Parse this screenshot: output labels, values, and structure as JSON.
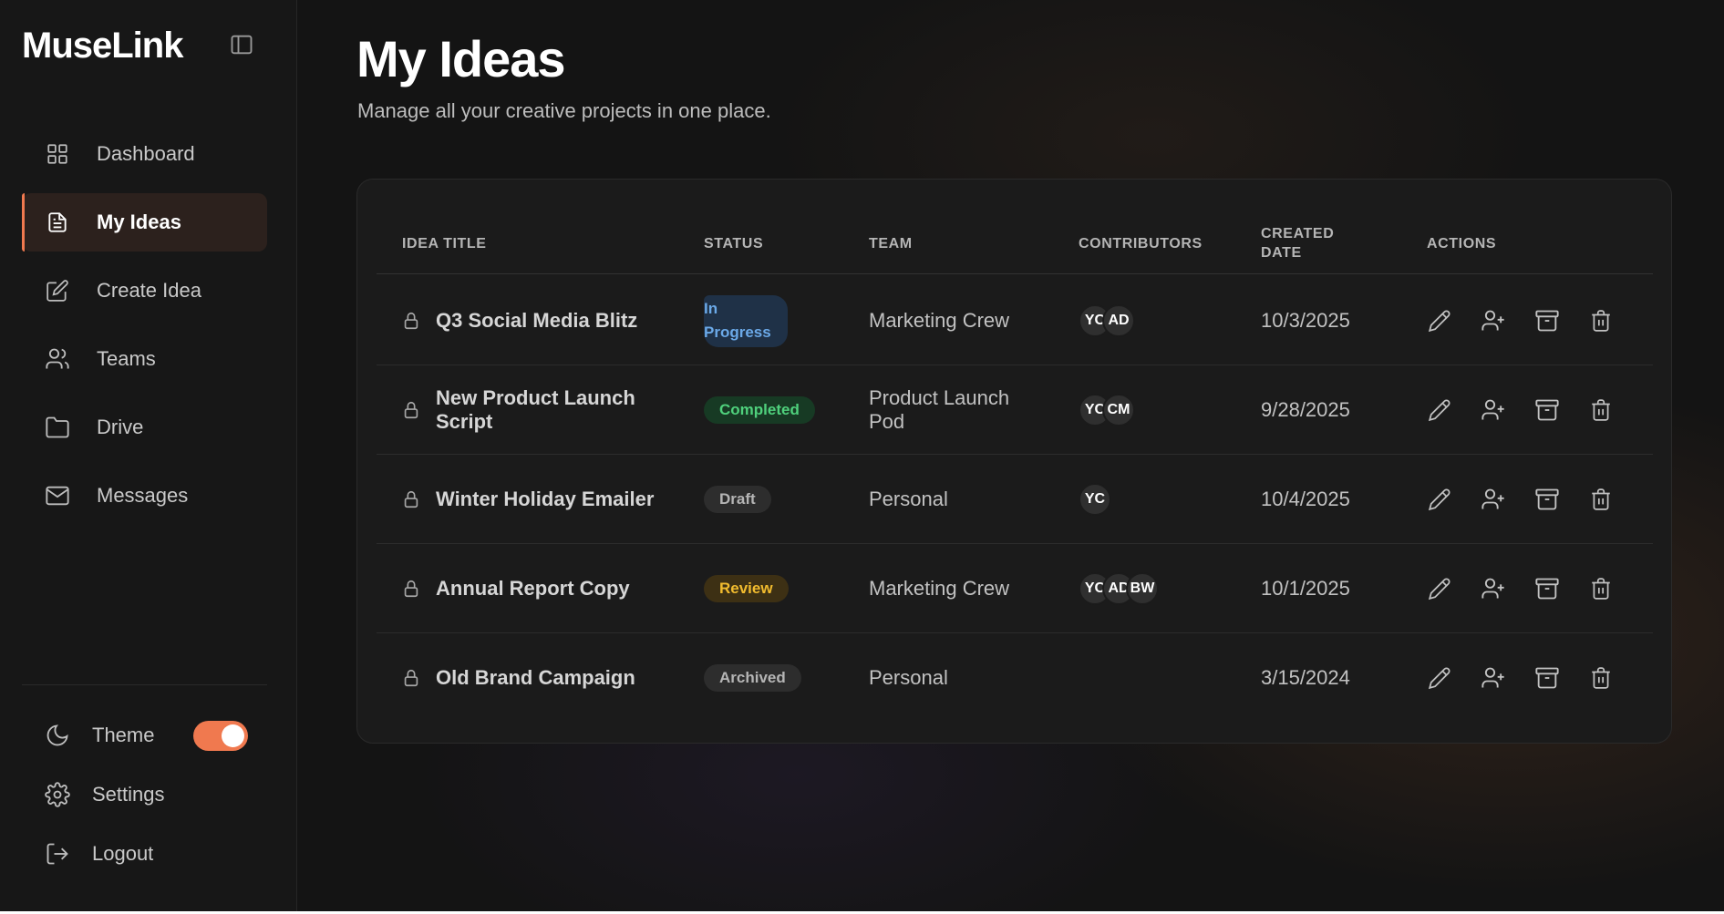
{
  "sidebar": {
    "brand": "MuseLink",
    "items": [
      {
        "label": "Dashboard",
        "icon": "grid-icon"
      },
      {
        "label": "My Ideas",
        "icon": "document-icon",
        "active": true
      },
      {
        "label": "Create Idea",
        "icon": "pencil-square-icon"
      },
      {
        "label": "Teams",
        "icon": "users-icon"
      },
      {
        "label": "Drive",
        "icon": "folder-icon"
      },
      {
        "label": "Messages",
        "icon": "mail-icon"
      }
    ],
    "theme_label": "Theme",
    "theme_on": true,
    "settings_label": "Settings",
    "logout_label": "Logout"
  },
  "header": {
    "title": "My Ideas",
    "subtitle": "Manage all your creative projects in one place."
  },
  "table": {
    "columns": {
      "title": "Idea Title",
      "status": "Status",
      "team": "Team",
      "contributors": "Contributors",
      "created": "Created Date",
      "actions": "Actions"
    },
    "rows": [
      {
        "title": "Q3 Social Media Blitz",
        "status": "In Progress",
        "status_kind": "progress",
        "team": "Marketing Crew",
        "contributors": [
          "YC",
          "AD"
        ],
        "date": "10/3/2025"
      },
      {
        "title": "New Product Launch Script",
        "status": "Completed",
        "status_kind": "completed",
        "team": "Product Launch Pod",
        "contributors": [
          "YC",
          "CM"
        ],
        "date": "9/28/2025"
      },
      {
        "title": "Winter Holiday Emailer",
        "status": "Draft",
        "status_kind": "draft",
        "team": "Personal",
        "contributors": [
          "YC"
        ],
        "date": "10/4/2025"
      },
      {
        "title": "Annual Report Copy",
        "status": "Review",
        "status_kind": "review",
        "team": "Marketing Crew",
        "contributors": [
          "YC",
          "AD",
          "BW"
        ],
        "date": "10/1/2025"
      },
      {
        "title": "Old Brand Campaign",
        "status": "Archived",
        "status_kind": "archived",
        "team": "Personal",
        "contributors": [],
        "date": "3/15/2024"
      }
    ]
  },
  "colors": {
    "accent": "#f0794f",
    "background": "#141414",
    "sidebar": "#171717"
  }
}
